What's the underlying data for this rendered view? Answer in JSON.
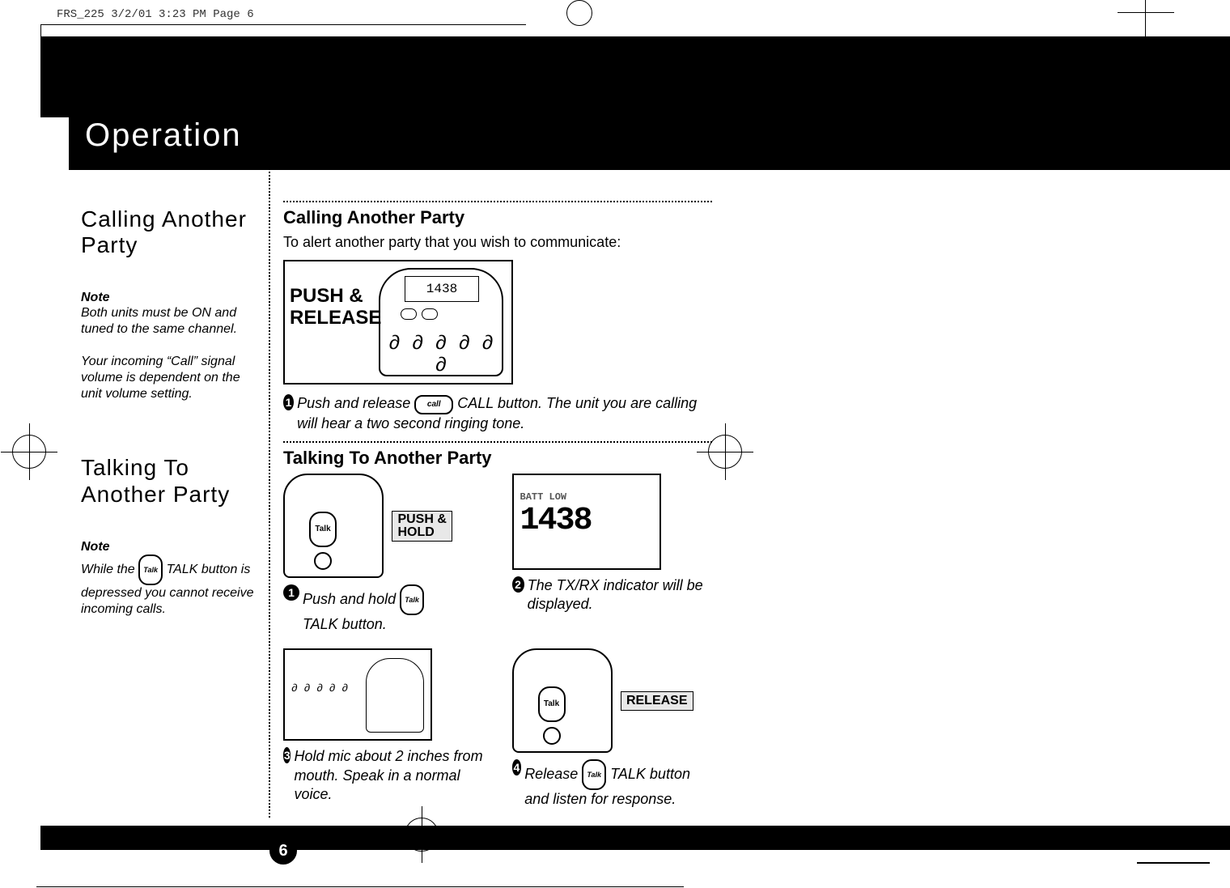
{
  "meta": {
    "header": "FRS_225  3/2/01  3:23 PM  Page 6"
  },
  "title": "Operation",
  "page_number": "6",
  "sidebar": {
    "calling": {
      "heading": "Calling Another Party",
      "note_label": "Note",
      "note_text1": "Both units must be ON and tuned to the same channel.",
      "note_text2": "Your incoming “Call” signal volume is dependent on the unit volume setting."
    },
    "talking": {
      "heading": "Talking To Another Party",
      "note_label": "Note",
      "note_text_pre": "While the ",
      "note_text_post": " TALK button is depressed you cannot receive incoming calls."
    }
  },
  "main": {
    "calling": {
      "heading": "Calling Another Party",
      "intro": "To alert another party that you wish to communicate:",
      "push_release_label1": "PUSH &",
      "push_release_label2": "RELEASE",
      "radio_screen": "1438",
      "step1_num": "1",
      "step1_pre": "Push and release ",
      "step1_post": " CALL button. The unit you are calling will hear a two second ringing tone."
    },
    "talking": {
      "heading": "Talking To Another Party",
      "push_hold_label": "PUSH & HOLD",
      "release_label": "RELEASE",
      "lcd_header": "BATT LOW",
      "lcd_value": "1438",
      "step1_num": "1",
      "step1_pre": "Push and hold ",
      "step1_post": " TALK button.",
      "step2_num": "2",
      "step2_text": "The TX/RX indicator will be displayed.",
      "step3_num": "3",
      "step3_text": "Hold mic about 2 inches from mouth. Speak in a normal voice.",
      "step4_num": "4",
      "step4_pre": "Release ",
      "step4_post": " TALK button and listen for response."
    }
  },
  "icons": {
    "talk": "Talk",
    "call": "call"
  }
}
